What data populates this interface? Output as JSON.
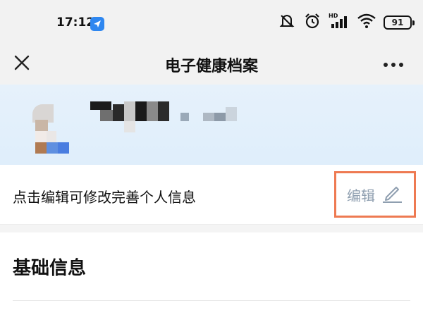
{
  "status_bar": {
    "time": "17:12",
    "battery": "91",
    "icons": [
      "app-notification-icon",
      "mute-icon",
      "alarm-icon",
      "hd-signal-icon",
      "wifi-icon",
      "battery-icon"
    ]
  },
  "nav": {
    "title": "电子健康档案",
    "close_icon": "close-icon",
    "more_icon": "more-icon"
  },
  "profile": {
    "avatar_icon": "avatar-blurred",
    "name_redacted": true
  },
  "edit": {
    "hint": "点击编辑可修改完善个人信息",
    "label": "编辑",
    "icon": "pencil-icon",
    "highlight_color": "#ee7a52"
  },
  "section": {
    "title": "基础信息"
  },
  "colors": {
    "accent": "#2f87f0",
    "banner": "#e6f1fb",
    "edit_text": "#8f9fb0"
  }
}
